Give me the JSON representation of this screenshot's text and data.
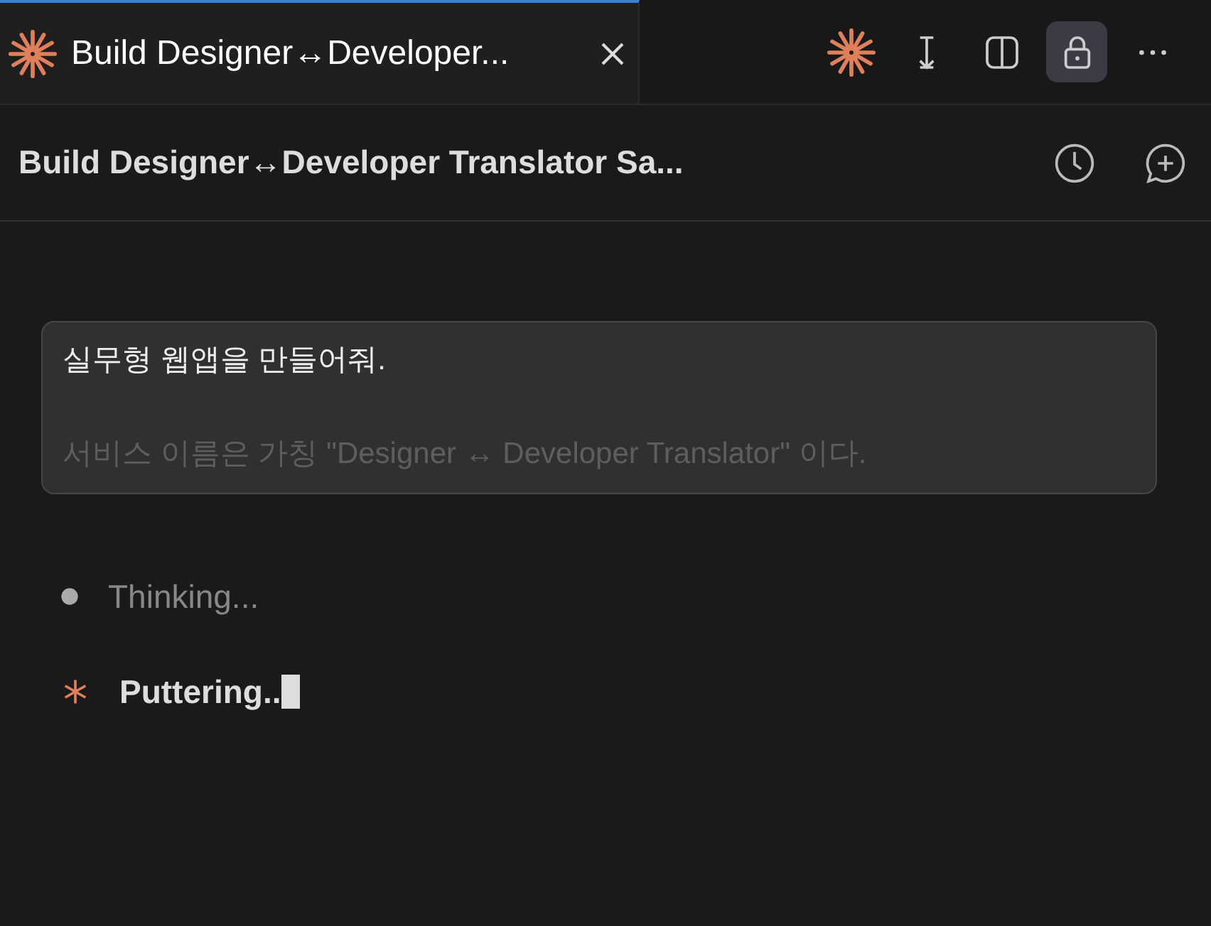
{
  "tab": {
    "title": "Build Designer↔Developer...",
    "selected": true
  },
  "toolbar": [
    {
      "kind": "spark",
      "selected": false
    },
    {
      "kind": "scroll",
      "selected": false
    },
    {
      "kind": "split",
      "selected": false
    },
    {
      "kind": "lock",
      "selected": true
    },
    {
      "kind": "more",
      "selected": false
    }
  ],
  "header": {
    "title": "Build Designer↔Developer Translator Sa..."
  },
  "message": {
    "lines": [
      {
        "text": "실무형 웹앱을 만들어줘.",
        "faded": false
      },
      {
        "text": "서비스 이름은 가칭 \"Designer ↔ Developer Translator\" 이다.",
        "faded": true
      }
    ]
  },
  "status": [
    {
      "kind": "bullet",
      "text": "Thinking..."
    },
    {
      "kind": "spinner",
      "text": "Puttering.."
    }
  ]
}
